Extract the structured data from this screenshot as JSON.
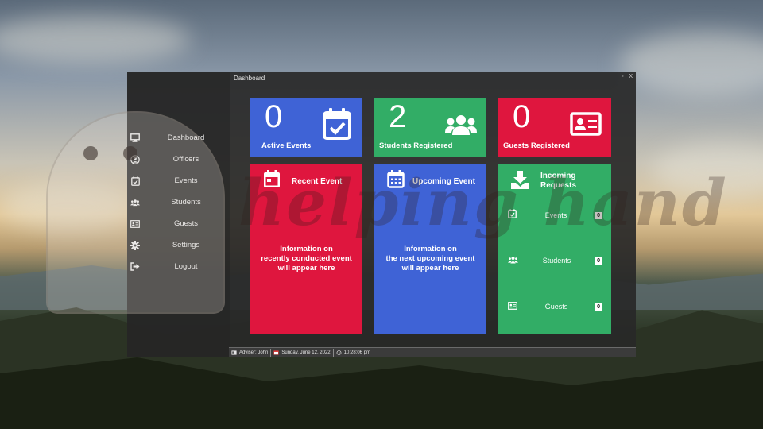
{
  "window": {
    "title": "Dashboard",
    "controls": {
      "minimize": "_",
      "maximize": "▫",
      "close": "X"
    }
  },
  "watermark": "helping hand",
  "sidebar": {
    "items": [
      {
        "label": "Dashboard",
        "icon": "monitor-icon"
      },
      {
        "label": "Officers",
        "icon": "user-circle-icon"
      },
      {
        "label": "Events",
        "icon": "calendar-check-icon"
      },
      {
        "label": "Students",
        "icon": "users-icon"
      },
      {
        "label": "Guests",
        "icon": "id-card-icon"
      },
      {
        "label": "Settings",
        "icon": "gear-icon"
      },
      {
        "label": "Logout",
        "icon": "logout-icon"
      }
    ]
  },
  "stats": {
    "active_events": {
      "value": "0",
      "label": "Active Events",
      "color": "#3f63d6",
      "icon": "calendar-check-icon"
    },
    "students_registered": {
      "value": "2",
      "label": "Students Registered",
      "color": "#32ad66",
      "icon": "users-icon"
    },
    "guests_registered": {
      "value": "0",
      "label": "Guests Registered",
      "color": "#df163e",
      "icon": "id-card-icon"
    }
  },
  "panels": {
    "recent_event": {
      "title": "Recent Event",
      "body": [
        "Information on",
        "recently conducted event",
        "will appear here"
      ],
      "color": "#df163e"
    },
    "upcoming_event": {
      "title": "Upcoming Event",
      "body": [
        "Information on",
        "the next upcoming event",
        "will appear here"
      ],
      "color": "#3f63d6"
    },
    "incoming_requests": {
      "title_line1": "Incoming",
      "title_line2": "Requests",
      "color": "#32ad66",
      "rows": [
        {
          "label": "Events",
          "count": "0",
          "icon": "calendar-check-icon"
        },
        {
          "label": "Students",
          "count": "0",
          "icon": "users-icon"
        },
        {
          "label": "Guests",
          "count": "0",
          "icon": "id-card-icon"
        }
      ]
    }
  },
  "statusbar": {
    "adviser": "Adviser: John",
    "date": "Sunday, June 12, 2022",
    "time": "10:28:06 pm"
  }
}
